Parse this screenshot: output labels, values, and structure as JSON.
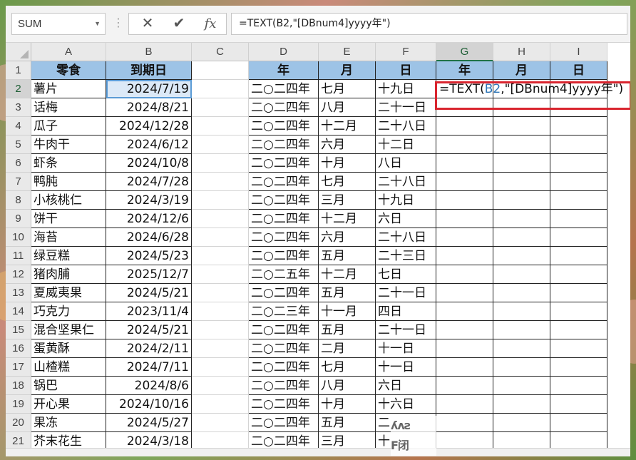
{
  "formula_bar": {
    "name_box": "SUM",
    "cancel_glyph": "✕",
    "enter_glyph": "✔",
    "fx_glyph": "fx",
    "formula": "=TEXT(B2,\"[DBnum4]yyyy年\")"
  },
  "columns": [
    "A",
    "B",
    "C",
    "D",
    "E",
    "F",
    "G",
    "H",
    "I"
  ],
  "active_column": "G",
  "active_row": 2,
  "headers": {
    "A": "零食",
    "B": "到期日",
    "D": "年",
    "E": "月",
    "F": "日",
    "G": "年",
    "H": "月",
    "I": "日"
  },
  "rows": [
    {
      "n": "2",
      "a": "薯片",
      "b": "2024/7/19",
      "d": "二○二四年",
      "e": "七月",
      "f": "十九日"
    },
    {
      "n": "3",
      "a": "话梅",
      "b": "2024/8/21",
      "d": "二○二四年",
      "e": "八月",
      "f": "二十一日"
    },
    {
      "n": "4",
      "a": "瓜子",
      "b": "2024/12/28",
      "d": "二○二四年",
      "e": "十二月",
      "f": "二十八日"
    },
    {
      "n": "5",
      "a": "牛肉干",
      "b": "2024/6/12",
      "d": "二○二四年",
      "e": "六月",
      "f": "十二日"
    },
    {
      "n": "6",
      "a": "虾条",
      "b": "2024/10/8",
      "d": "二○二四年",
      "e": "十月",
      "f": "八日"
    },
    {
      "n": "7",
      "a": "鸭肫",
      "b": "2024/7/28",
      "d": "二○二四年",
      "e": "七月",
      "f": "二十八日"
    },
    {
      "n": "8",
      "a": "小核桃仁",
      "b": "2024/3/19",
      "d": "二○二四年",
      "e": "三月",
      "f": "十九日"
    },
    {
      "n": "9",
      "a": "饼干",
      "b": "2024/12/6",
      "d": "二○二四年",
      "e": "十二月",
      "f": "六日"
    },
    {
      "n": "10",
      "a": "海苔",
      "b": "2024/6/28",
      "d": "二○二四年",
      "e": "六月",
      "f": "二十八日"
    },
    {
      "n": "11",
      "a": "绿豆糕",
      "b": "2024/5/23",
      "d": "二○二四年",
      "e": "五月",
      "f": "二十三日"
    },
    {
      "n": "12",
      "a": "猪肉脯",
      "b": "2025/12/7",
      "d": "二○二五年",
      "e": "十二月",
      "f": "七日"
    },
    {
      "n": "13",
      "a": "夏威夷果",
      "b": "2024/5/21",
      "d": "二○二四年",
      "e": "五月",
      "f": "二十一日"
    },
    {
      "n": "14",
      "a": "巧克力",
      "b": "2023/11/4",
      "d": "二○二三年",
      "e": "十一月",
      "f": "四日"
    },
    {
      "n": "15",
      "a": "混合坚果仁",
      "b": "2024/5/21",
      "d": "二○二四年",
      "e": "五月",
      "f": "二十一日"
    },
    {
      "n": "16",
      "a": "蛋黄酥",
      "b": "2024/2/11",
      "d": "二○二四年",
      "e": "二月",
      "f": "十一日"
    },
    {
      "n": "17",
      "a": "山楂糕",
      "b": "2024/7/11",
      "d": "二○二四年",
      "e": "七月",
      "f": "十一日"
    },
    {
      "n": "18",
      "a": "锅巴",
      "b": "2024/8/6",
      "d": "二○二四年",
      "e": "八月",
      "f": "六日"
    },
    {
      "n": "19",
      "a": "开心果",
      "b": "2024/10/16",
      "d": "二○二四年",
      "e": "十月",
      "f": "十六日"
    },
    {
      "n": "20",
      "a": "果冻",
      "b": "2024/5/27",
      "d": "二○二四年",
      "e": "五月",
      "f": "二"
    },
    {
      "n": "21",
      "a": "芥末花生",
      "b": "2024/3/18",
      "d": "二○二四年",
      "e": "三月",
      "f": "十"
    }
  ],
  "edit_cell": {
    "prefix": "=TEXT(",
    "ref": "B2",
    "suffix": ",\"[DBnum4]yyyy年\")"
  },
  "watermark": {
    "line1": "ʎᴧƨ",
    "line2": "F闭"
  },
  "colors": {
    "header_fill": "#9dc3e6",
    "highlight_border": "#d9252f",
    "selection": "#5b9bd5"
  }
}
